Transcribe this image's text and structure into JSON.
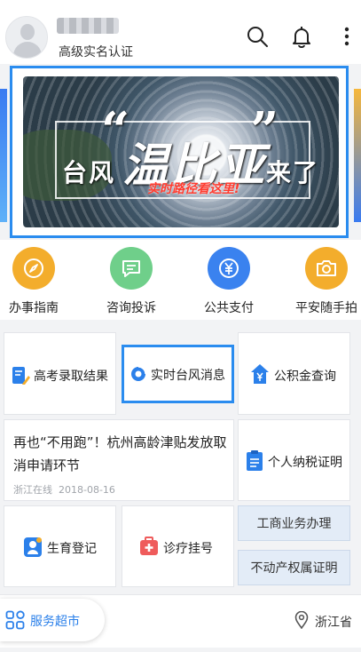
{
  "header": {
    "verify_text": "高级实名认证",
    "icons": [
      "search-icon",
      "bell-icon",
      "more-icon"
    ]
  },
  "banner": {
    "title_left": "台风",
    "title_main": "温比亚",
    "title_tail": "来了",
    "subtitle": "实时路径看这里!"
  },
  "quick_services": [
    {
      "label": "办事指南",
      "icon": "compass-icon",
      "color": "#f3ad2c"
    },
    {
      "label": "咨询投诉",
      "icon": "chat-icon",
      "color": "#6fcf8a"
    },
    {
      "label": "公共支付",
      "icon": "yuan-icon",
      "color": "#3a82ef"
    },
    {
      "label": "平安随手拍",
      "icon": "camera-icon",
      "color": "#f3ad2c"
    }
  ],
  "grid": {
    "gaokao": "高考录取结果",
    "typhoon": "实时台风消息",
    "fund": "公积金查询",
    "news_title": "再也“不用跑”！杭州高龄津贴发放取消申请环节",
    "news_source": "浙江在线",
    "news_date": "2018-08-16",
    "tax": "个人纳税证明",
    "birth": "生育登记",
    "clinic": "诊疗挂号",
    "business": "工商业务办理",
    "property": "不动产权属证明"
  },
  "bottom": {
    "market": "服务超市",
    "location": "浙江省"
  },
  "colors": {
    "accent": "#2a8cef",
    "pill_bg": "#e3ecf7"
  }
}
